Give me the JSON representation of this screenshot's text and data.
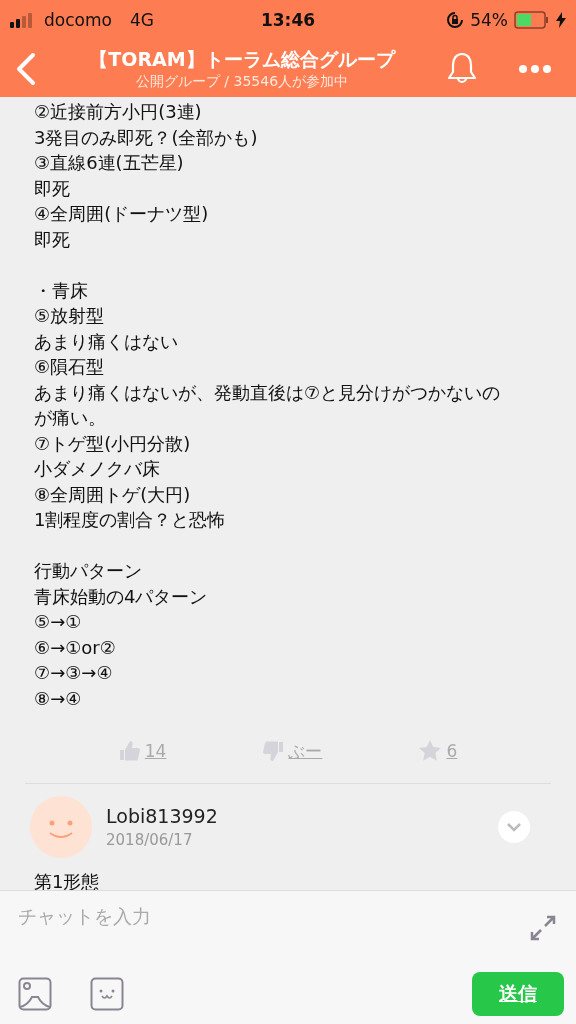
{
  "status_bar": {
    "carrier": "docomo",
    "network": "4G",
    "time": "13:46",
    "battery": "54%"
  },
  "header": {
    "title": "【TORAM】トーラム総合グループ",
    "subtitle": "公開グループ / 35546人が参加中"
  },
  "post": {
    "paragraphs": [
      [
        "②近接前方小円(3連)",
        "3発目のみ即死？(全部かも)",
        "③直線6連(五芒星)",
        "即死",
        "④全周囲(ドーナツ型)",
        "即死"
      ],
      [
        "・青床",
        "⑤放射型",
        "あまり痛くはない",
        "⑥隕石型",
        "あまり痛くはないが、発動直後は⑦と見分けがつかないのが痛い。",
        "⑦トゲ型(小円分散)",
        "小ダメノクバ床",
        "⑧全周囲トゲ(大円)",
        "1割程度の割合？と恐怖"
      ],
      [
        "行動パターン",
        "青床始動の4パターン",
        "⑤→①",
        "⑥→①or②",
        "⑦→③→④",
        "⑧→④"
      ]
    ],
    "reactions": [
      {
        "kind": "like",
        "count": "14"
      },
      {
        "kind": "boo",
        "count": "ぶー"
      },
      {
        "kind": "star",
        "count": "6"
      }
    ]
  },
  "comment": {
    "user": "Lobi813992",
    "date": "2018/06/17",
    "text": "第1形態"
  },
  "composer": {
    "placeholder": "チャットを入力",
    "send": "送信"
  }
}
